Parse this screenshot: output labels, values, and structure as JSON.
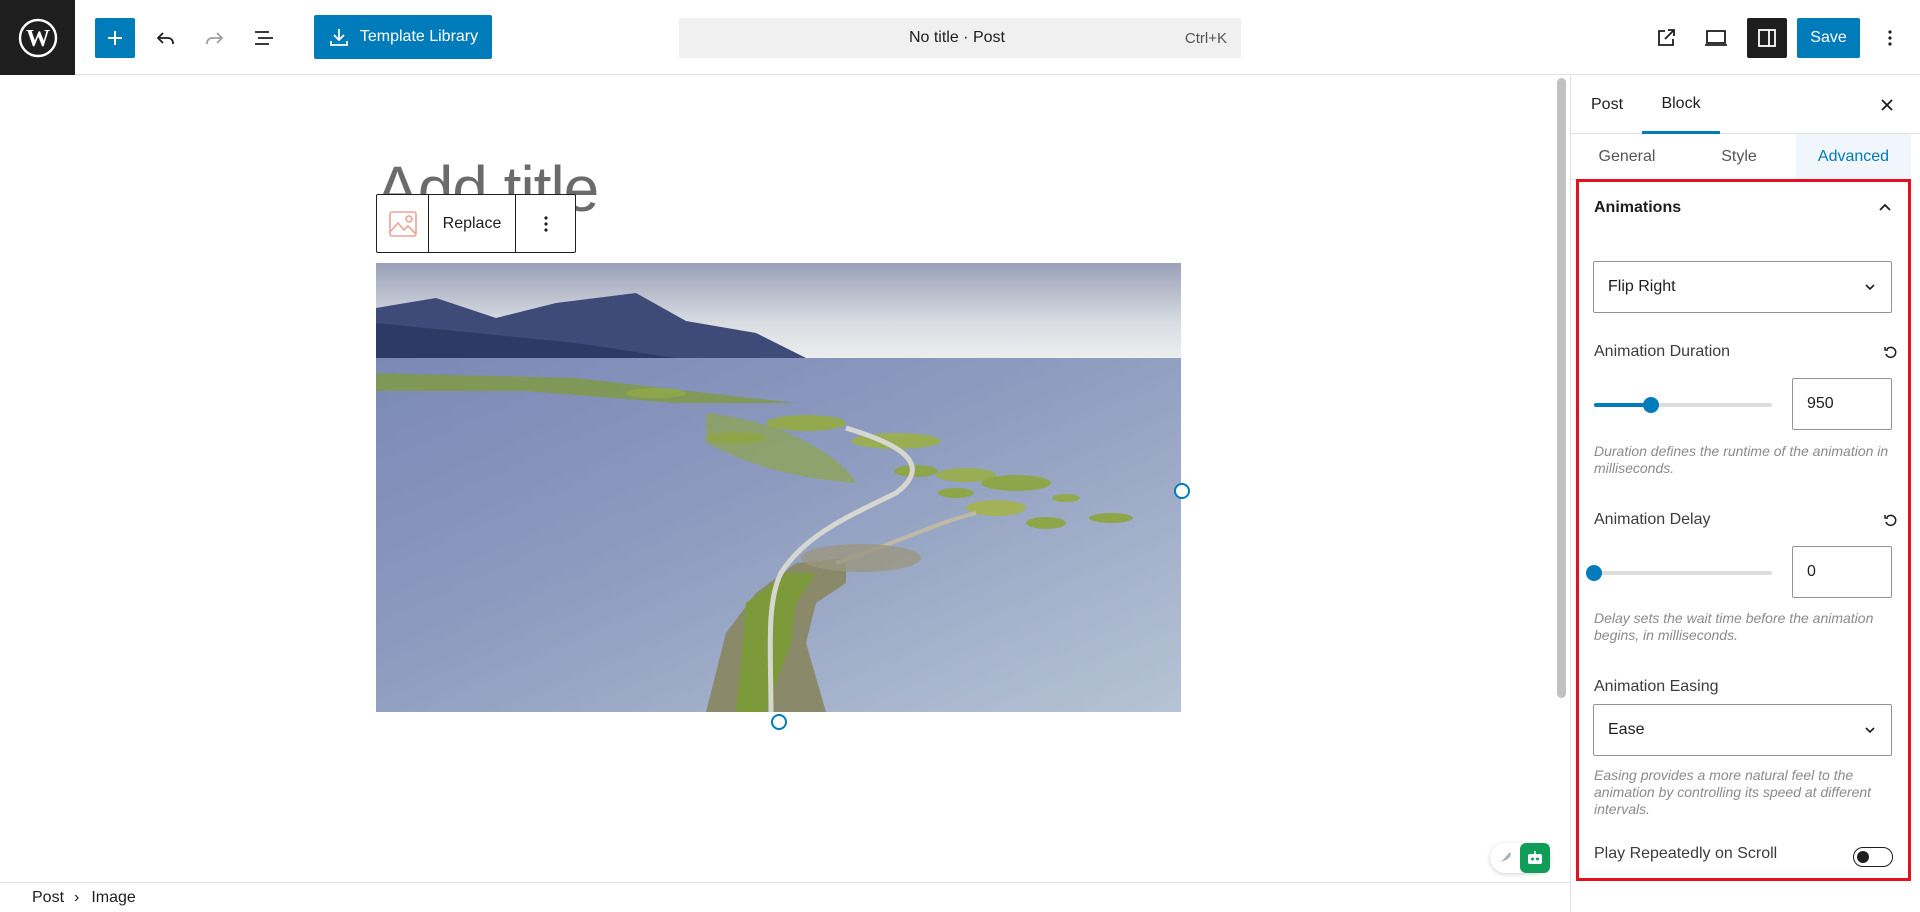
{
  "toolbar": {
    "template_library_label": "Template Library",
    "document_title": "No title · Post",
    "command_shortcut": "Ctrl+K",
    "save_label": "Save",
    "accent_color": "#007cba"
  },
  "editor": {
    "title_placeholder": "Add title",
    "block_toolbar": {
      "replace_label": "Replace"
    },
    "image_description": "aerial view of a winding road bridge across small islands in a fjord"
  },
  "breadcrumb": {
    "items": [
      "Post",
      "Image"
    ]
  },
  "sidebar": {
    "tabs": [
      "Post",
      "Block"
    ],
    "active_tab": "Block",
    "sub_tabs": [
      "General",
      "Style",
      "Advanced"
    ],
    "active_sub_tab": "Advanced",
    "panel": {
      "title": "Animations",
      "animation_type": "Flip Right",
      "duration": {
        "label": "Animation Duration",
        "value": "950",
        "slider_fraction": 0.32,
        "help": "Duration defines the runtime of the animation in milliseconds."
      },
      "delay": {
        "label": "Animation Delay",
        "value": "0",
        "slider_fraction": 0,
        "help": "Delay sets the wait time before the animation begins, in milliseconds."
      },
      "easing": {
        "label": "Animation Easing",
        "value": "Ease",
        "help": "Easing provides a more natural feel to the animation by controlling its speed at different intervals."
      },
      "repeat": {
        "label": "Play Repeatedly on Scroll",
        "enabled": false
      }
    },
    "highlight_color": "#e4101f"
  }
}
